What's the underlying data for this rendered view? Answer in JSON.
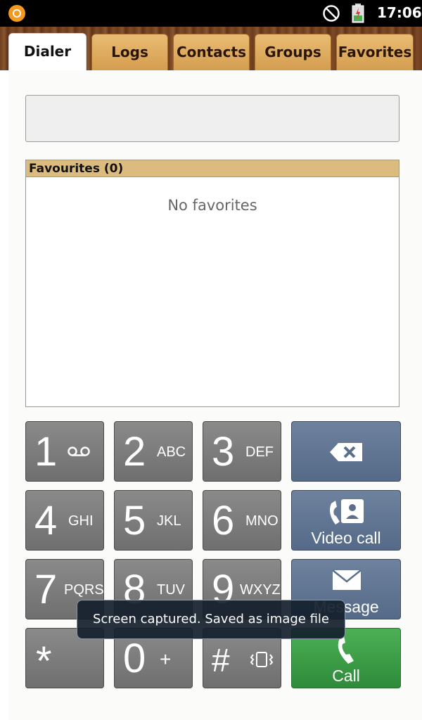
{
  "status_bar": {
    "time": "17:06",
    "icons": [
      "app-notification-icon",
      "no-signal-icon",
      "battery-charging-icon"
    ]
  },
  "tabs": [
    {
      "label": "Dialer",
      "active": true
    },
    {
      "label": "Logs",
      "active": false
    },
    {
      "label": "Contacts",
      "active": false
    },
    {
      "label": "Groups",
      "active": false
    },
    {
      "label": "Favorites",
      "active": false
    }
  ],
  "dialer": {
    "number_value": ""
  },
  "favorites": {
    "header": "Favourites (0)",
    "empty_text": "No favorites"
  },
  "keypad": [
    {
      "digit": "1",
      "letters": "",
      "icon": "voicemail-icon"
    },
    {
      "digit": "2",
      "letters": "ABC"
    },
    {
      "digit": "3",
      "letters": "DEF"
    },
    {
      "digit": "4",
      "letters": "GHI"
    },
    {
      "digit": "5",
      "letters": "JKL"
    },
    {
      "digit": "6",
      "letters": "MNO"
    },
    {
      "digit": "7",
      "letters": "PQRS"
    },
    {
      "digit": "8",
      "letters": "TUV"
    },
    {
      "digit": "9",
      "letters": "WXYZ"
    },
    {
      "digit": "*",
      "letters": ""
    },
    {
      "digit": "0",
      "letters": "+"
    },
    {
      "digit": "#",
      "letters": "",
      "icon": "vibrate-icon"
    }
  ],
  "actions": {
    "backspace": {
      "icon": "backspace-icon"
    },
    "video_call": {
      "label": "Video call",
      "icon": "video-call-icon"
    },
    "message": {
      "label": "Message",
      "icon": "envelope-icon"
    },
    "call": {
      "label": "Call",
      "icon": "phone-icon"
    }
  },
  "toast": {
    "text": "Screen captured. Saved as image file"
  },
  "colors": {
    "tab_wood": "#7a4626",
    "tab_inactive": "#e0ad63",
    "fav_header": "#dcbb7e",
    "key_gray": "#7d7d7d",
    "action_blue": "#627893",
    "call_green": "#3e9f48"
  }
}
